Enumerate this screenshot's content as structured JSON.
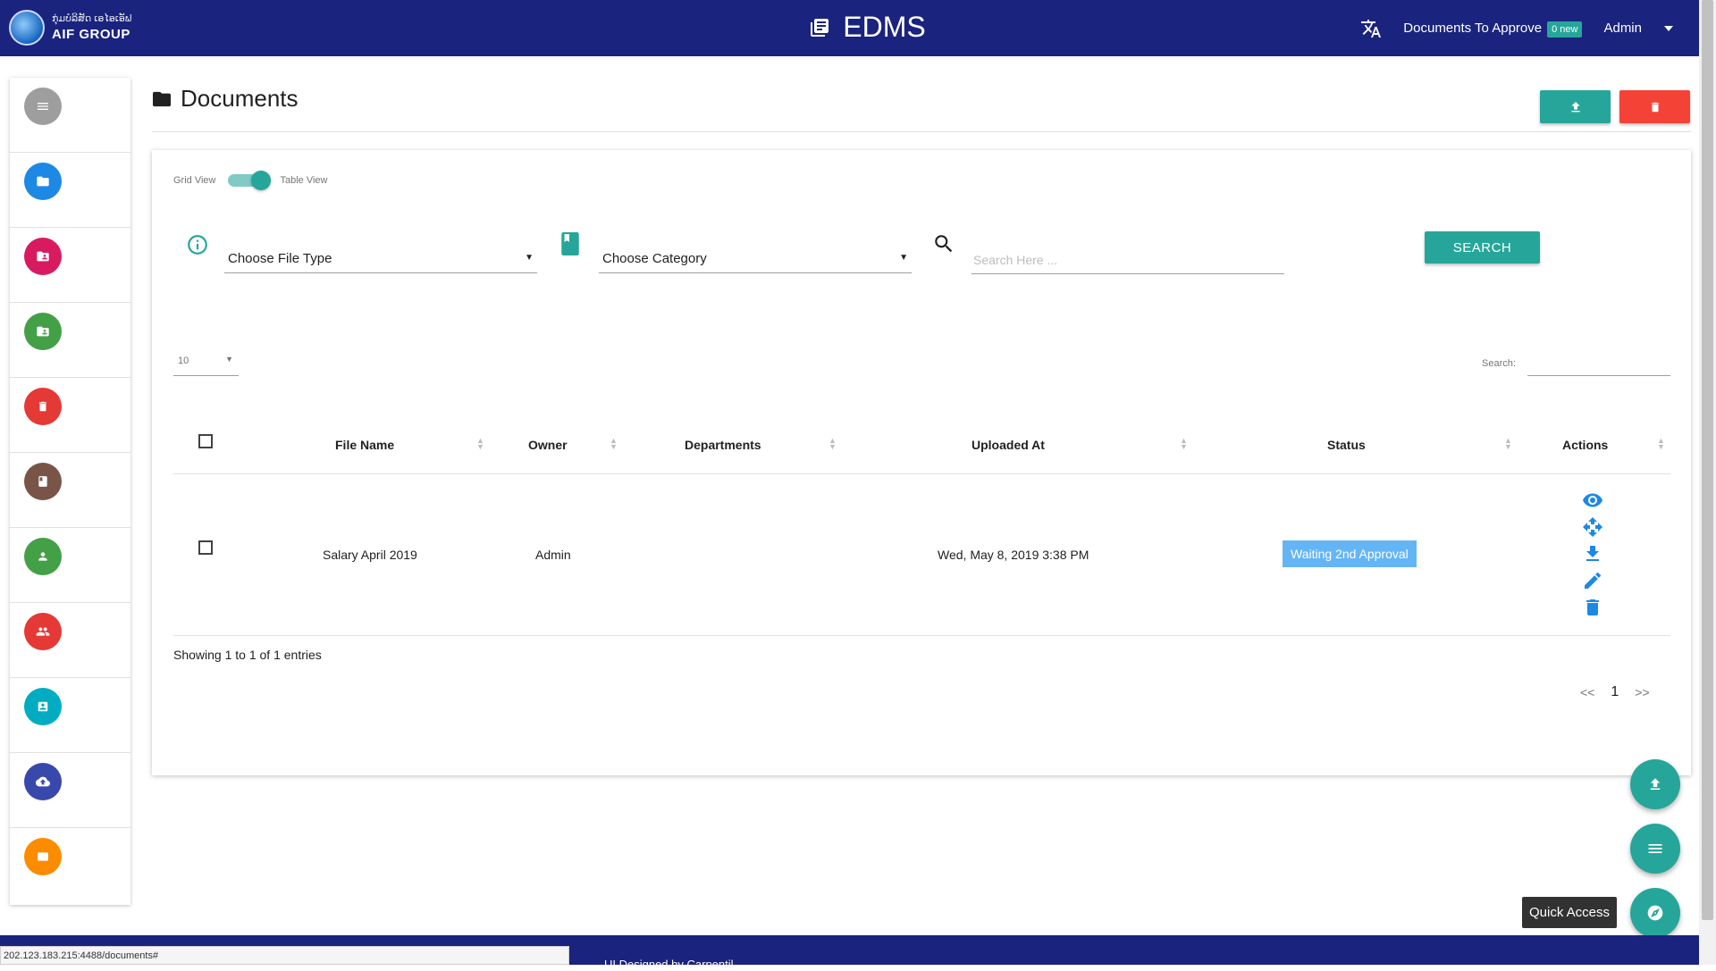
{
  "navbar": {
    "brand_line1": "ກຸ່ມບໍລິສັດ ເອໄອເອັຟ",
    "brand_name": "AIF GROUP",
    "app_title": "EDMS",
    "translate_icon": "translate-icon",
    "approvals_label": "Documents To Approve",
    "approvals_badge": "0 new",
    "user_label": "Admin"
  },
  "sidebar": {
    "items": [
      {
        "icon": "menu-icon",
        "color": "#9e9e9e"
      },
      {
        "icon": "folder-icon",
        "color": "#1e88e5"
      },
      {
        "icon": "folder-shared-icon",
        "color": "#d81b60"
      },
      {
        "icon": "folder-shared-icon",
        "color": "#43a047"
      },
      {
        "icon": "trash-icon",
        "color": "#e53935"
      },
      {
        "icon": "book-icon",
        "color": "#795548"
      },
      {
        "icon": "person-icon",
        "color": "#43a047"
      },
      {
        "icon": "group-icon",
        "color": "#e53935"
      },
      {
        "icon": "contact-icon",
        "color": "#00acc1"
      },
      {
        "icon": "cloud-upload-icon",
        "color": "#3949ab"
      },
      {
        "icon": "card-icon",
        "color": "#fb8c00"
      }
    ]
  },
  "page": {
    "title": "Documents"
  },
  "filters": {
    "grid_view_label": "Grid View",
    "table_view_label": "Table View",
    "file_type_value": "Choose File Type",
    "category_value": "Choose Category",
    "search_placeholder": "Search Here ...",
    "search_button": "SEARCH"
  },
  "table_controls": {
    "page_length": "10",
    "search_label": "Search:"
  },
  "table": {
    "columns": [
      "File Name",
      "Owner",
      "Departments",
      "Uploaded At",
      "Status",
      "Actions"
    ],
    "rows": [
      {
        "file_name": "Salary April 2019",
        "owner": "Admin",
        "departments": "",
        "uploaded_at": "Wed, May 8, 2019 3:38 PM",
        "status": "Waiting 2nd Approval"
      }
    ],
    "info": "Showing 1 to 1 of 1 entries"
  },
  "pagination": {
    "prev": "<<",
    "current": "1",
    "next": ">>"
  },
  "quick_access": {
    "tooltip": "Quick Access"
  },
  "colors": {
    "navbar": "#1a237e",
    "accent": "#26a69a",
    "danger": "#f44336",
    "status_badge": "#64b5f6",
    "action_icon": "#1e88e5"
  },
  "footer": {
    "text": "UI Designed by Carpentil..."
  },
  "status_bar": {
    "url": "202.123.183.215:4488/documents#"
  }
}
